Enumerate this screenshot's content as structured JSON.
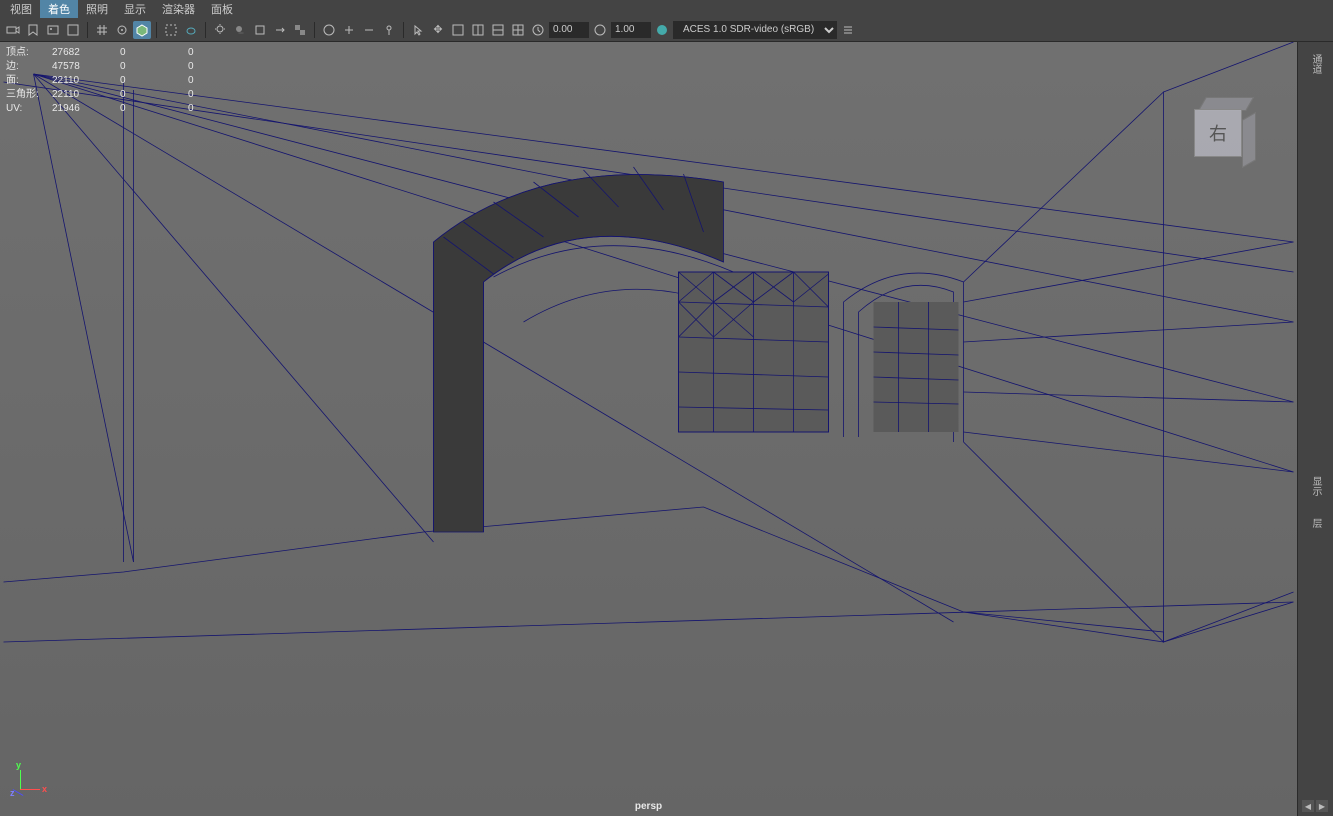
{
  "menu": {
    "items": [
      "视图",
      "着色",
      "照明",
      "显示",
      "渲染器",
      "面板"
    ],
    "active_index": 1
  },
  "toolbar": {
    "field1_label": "",
    "field1_value": "0.00",
    "field2_label": "",
    "field2_value": "1.00",
    "color_space": "ACES 1.0 SDR-video (sRGB)"
  },
  "stats": {
    "rows": [
      {
        "label": "顶点:",
        "v1": "27682",
        "v2": "0",
        "v3": "0"
      },
      {
        "label": "边:",
        "v1": "47578",
        "v2": "0",
        "v3": "0"
      },
      {
        "label": "面:",
        "v1": "22110",
        "v2": "0",
        "v3": "0"
      },
      {
        "label": "三角形:",
        "v1": "22110",
        "v2": "0",
        "v3": "0"
      },
      {
        "label": "UV:",
        "v1": "21946",
        "v2": "0",
        "v3": "0"
      }
    ]
  },
  "viewcube": {
    "face_label": "右"
  },
  "axis": {
    "x": "x",
    "y": "y",
    "z": "z"
  },
  "camera": "persp",
  "right_panel": {
    "tabs": [
      "通道",
      "显示",
      "层"
    ]
  },
  "colors": {
    "wireframe": "#14146e",
    "viewport_bg": "#6a6a6a",
    "ui_bg": "#444444",
    "accent": "#5285a6"
  }
}
